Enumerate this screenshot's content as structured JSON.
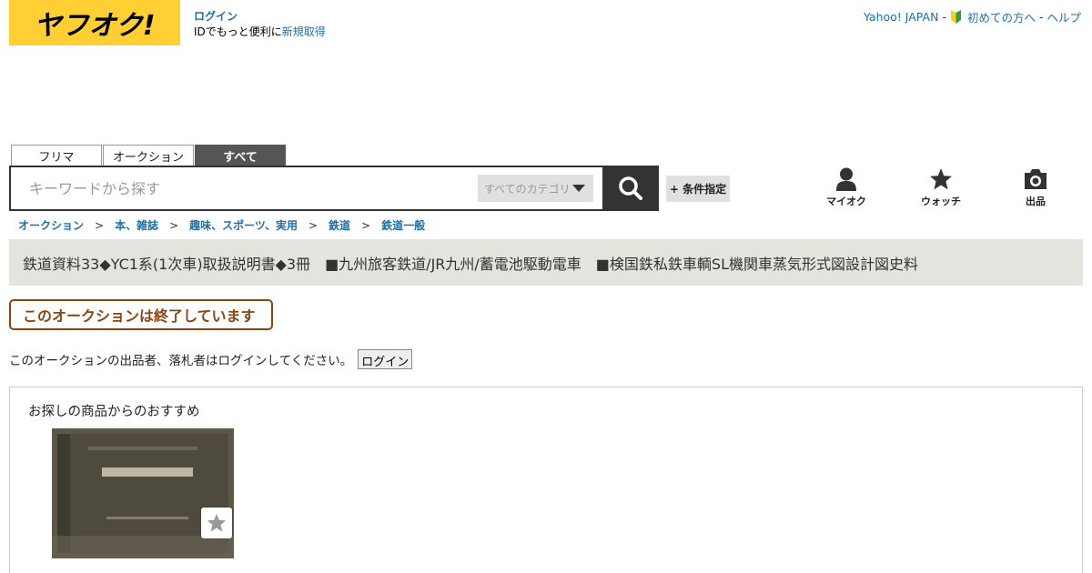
{
  "header": {
    "logo_text": "ヤフオク!",
    "login_link": "ログイン",
    "login_prompt_prefix": "IDでもっと便利に",
    "register_link": "新規取得",
    "util_links": {
      "yahoo_japan": "Yahoo! JAPAN",
      "beginner": "初めての方へ",
      "help": "ヘルプ",
      "separator": "-"
    }
  },
  "tabs": [
    {
      "label": "フリマ",
      "active": false
    },
    {
      "label": "オークション",
      "active": false
    },
    {
      "label": "すべて",
      "active": true
    }
  ],
  "search": {
    "placeholder": "キーワードから探す",
    "value": "",
    "category_selected": "すべてのカテゴリ",
    "condition_button": "+ 条件指定"
  },
  "nav": {
    "my_auction": "マイオク",
    "watch": "ウォッチ",
    "sell": "出品"
  },
  "breadcrumb": [
    "オークション",
    "本、雑誌",
    "趣味、スポーツ、実用",
    "鉄道",
    "鉄道一般"
  ],
  "breadcrumb_separator": ">",
  "item": {
    "title": "鉄道資料33◆YC1系(1次車)取扱説明書◆3冊　■九州旅客鉄道/JR九州/蓄電池駆動電車　■検国鉄私鉄車輌SL機関車蒸気形式図設計図史料"
  },
  "status": {
    "ended_label": "このオークションは終了しています",
    "login_notice": "このオークションの出品者、落札者はログインしてください。",
    "login_button": "ログイン"
  },
  "recommendations": {
    "title": "お探しの商品からのおすすめ"
  },
  "colors": {
    "brand_yellow": "#ffcf33",
    "link_blue": "#1e6fa8",
    "ended_brown": "#8b4513",
    "title_bar_bg": "#e5e3de"
  }
}
